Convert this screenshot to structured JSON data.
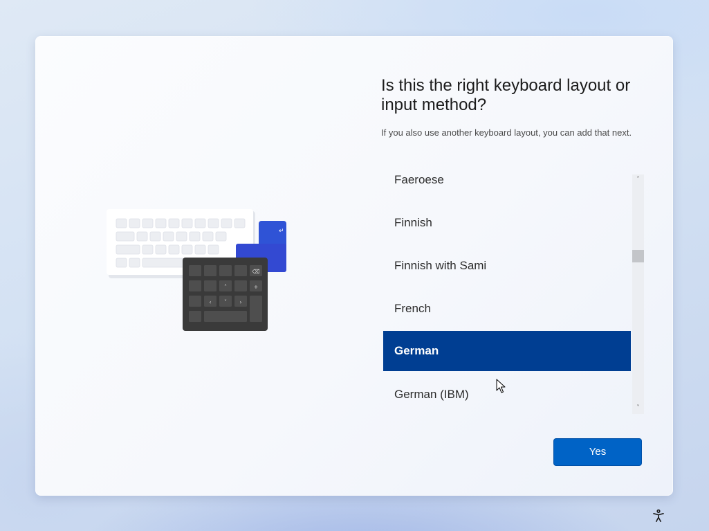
{
  "dialog": {
    "title": "Is this the right keyboard layout or input method?",
    "subtitle": "If you also use another keyboard layout, you can add that next."
  },
  "layouts": {
    "items": [
      {
        "label": "Faeroese"
      },
      {
        "label": "Finnish"
      },
      {
        "label": "Finnish with Sami"
      },
      {
        "label": "French"
      },
      {
        "label": "German"
      },
      {
        "label": "German (IBM)"
      }
    ],
    "selected_label": "German"
  },
  "actions": {
    "yes_label": "Yes"
  },
  "icons": {
    "illustration": "keyboard-illustration-icon",
    "scroll_up": "chevron-up-icon",
    "scroll_down": "chevron-down-icon",
    "accessibility": "accessibility-icon",
    "cursor": "mouse-pointer-icon"
  },
  "colors": {
    "accent": "#0063c6",
    "selection": "#003e92",
    "text": "#1b1b1b"
  }
}
